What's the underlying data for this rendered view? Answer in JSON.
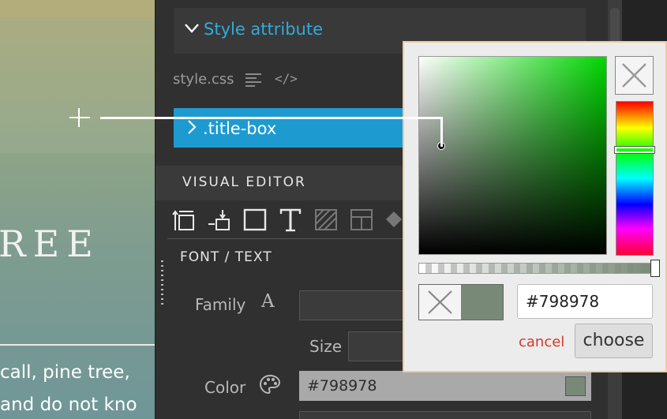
{
  "canvas": {
    "heading_fragment": "REE",
    "paragraph_line_1": "call, pine tree,",
    "paragraph_line_2": "and do not kno"
  },
  "panel": {
    "style_section_title": "Style attribute",
    "stylesheet_name": "style.css",
    "selector": ".title-box",
    "visual_editor_title": "VISUAL EDITOR",
    "font_section_title": "FONT / TEXT",
    "labels": {
      "family": "Family",
      "size": "Size",
      "color": "Color"
    },
    "color_value": "#798978"
  },
  "picker": {
    "hex_value": "#798978",
    "cancel_label": "cancel",
    "choose_label": "choose",
    "current_color": "#798978",
    "hue_color": "#00d600",
    "alpha_percent": 100
  },
  "colors": {
    "accent_blue": "#1d9bd1",
    "title_blue": "#33aadd",
    "cancel_red": "#d23a2c"
  },
  "icons": {
    "toolbar": [
      "spacing-icon",
      "position-icon",
      "border-icon",
      "typography-icon",
      "background-icon",
      "layout-icon",
      "more-icon"
    ]
  }
}
